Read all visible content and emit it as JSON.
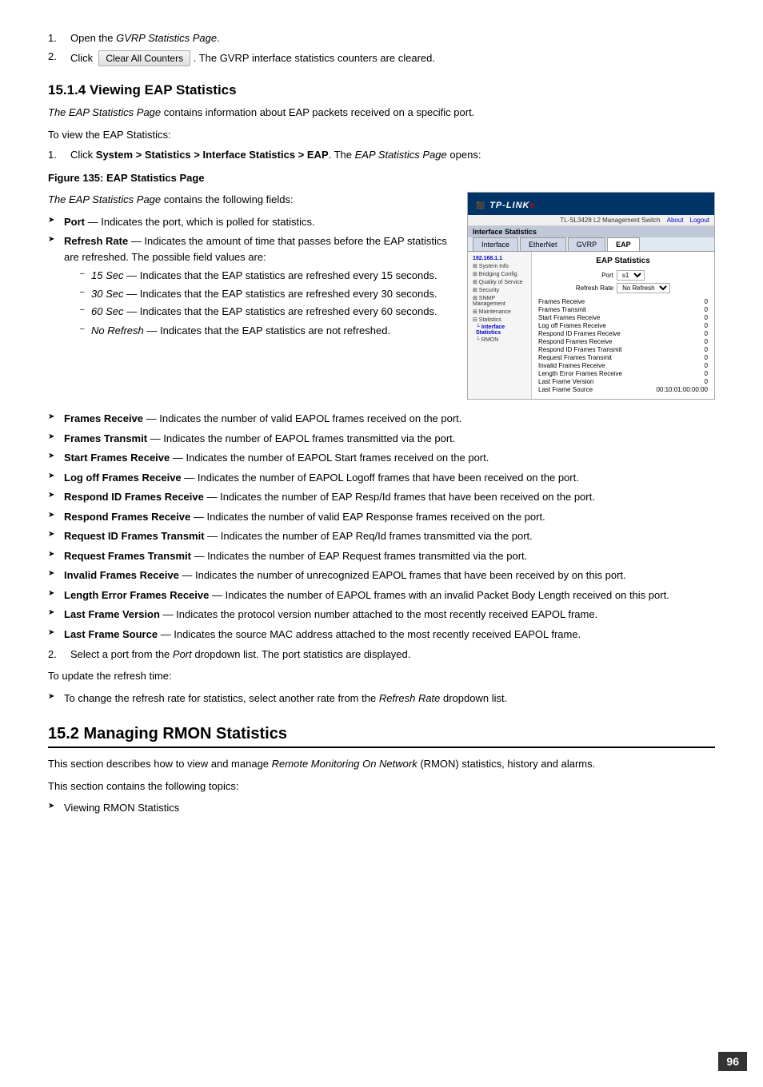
{
  "page": {
    "number": "96"
  },
  "steps_intro": [
    {
      "num": "1.",
      "text": "Open the ",
      "link": "GVRP Statistics Page",
      "suffix": "."
    },
    {
      "num": "2.",
      "text": "Click",
      "button": "Clear All Counters",
      "suffix": ". The GVRP interface statistics counters are cleared."
    }
  ],
  "section_154": {
    "heading": "15.1.4   Viewing EAP Statistics",
    "intro": "The EAP Statistics Page contains information about EAP packets received on a specific port.",
    "to_view": "To view the EAP Statistics:",
    "step1": "Click System > Statistics > Interface Statistics > EAP. The EAP Statistics Page opens:",
    "figure_caption": "Figure 135: EAP Statistics Page",
    "fields_intro": "The EAP Statistics Page contains the following fields:",
    "fields": [
      {
        "label": "Port",
        "desc": "— Indicates the port, which is polled for statistics."
      },
      {
        "label": "Refresh Rate",
        "desc": "— Indicates the amount of time that passes before the EAP statistics are refreshed. The possible field values are:"
      }
    ],
    "refresh_values": [
      "15 Sec — Indicates that the EAP statistics are refreshed every 15 seconds.",
      "30 Sec — Indicates that the EAP statistics are refreshed every 30 seconds.",
      "60 Sec — Indicates that the EAP statistics are refreshed every 60 seconds."
    ],
    "no_refresh": "– No Refresh — Indicates that the EAP statistics are not refreshed.",
    "more_fields": [
      {
        "label": "Frames Receive",
        "desc": "— Indicates the number of valid EAPOL frames received on the port."
      },
      {
        "label": "Frames Transmit",
        "desc": "— Indicates the number of EAPOL frames transmitted via the port."
      },
      {
        "label": "Start Frames Receive",
        "desc": "— Indicates the number of EAPOL Start frames received on the port."
      },
      {
        "label": "Log off Frames Receive",
        "desc": "— Indicates the number of EAPOL Logoff frames that have been received on the port."
      },
      {
        "label": "Respond ID Frames Receive",
        "desc": "— Indicates the number of EAP Resp/Id frames that have been received on the port."
      },
      {
        "label": "Respond Frames Receive",
        "desc": "— Indicates the number of valid EAP Response frames received on the port."
      },
      {
        "label": "Request ID Frames Transmit",
        "desc": "— Indicates the number of EAP Req/Id frames transmitted via the port."
      },
      {
        "label": "Request Frames Transmit",
        "desc": "— Indicates the number of EAP Request frames transmitted via the port."
      },
      {
        "label": "Invalid Frames Receive",
        "desc": "— Indicates the number of unrecognized EAPOL frames that have been received by on this port."
      },
      {
        "label": "Length Error Frames Receive",
        "desc": "— Indicates the number of EAPOL frames with an invalid Packet Body Length received on this port."
      },
      {
        "label": "Last Frame Version",
        "desc": "— Indicates the protocol version number attached to the most recently received EAPOL frame."
      },
      {
        "label": "Last Frame Source",
        "desc": "— Indicates the source MAC address attached to the most recently received EAPOL frame."
      }
    ],
    "step2": "Select a port from the Port dropdown list. The port statistics are displayed.",
    "update_refresh": "To update the refresh time:",
    "refresh_bullet": "To change the refresh rate for statistics, select another rate from the Refresh Rate dropdown list."
  },
  "section_152": {
    "heading": "15.2   Managing RMON Statistics",
    "intro": "This section describes how to view and manage Remote Monitoring On Network (RMON) statistics, history and alarms.",
    "topics_intro": "This section contains the following topics:",
    "topics": [
      "Viewing RMON Statistics"
    ]
  },
  "tp_link_ui": {
    "logo": "TP-LINK",
    "system_title": "TL-SL3428 L2 Management Switch",
    "nav_links": [
      "About",
      "Logout"
    ],
    "tabs": [
      "Interface",
      "EtherNet",
      "GVRP",
      "EAP"
    ],
    "active_tab": "EAP",
    "sidebar_items": [
      "192.168.1.1",
      "System Info",
      "Bridging Config",
      "Quality of Service",
      "Security",
      "SNMP Management",
      "Maintenance",
      "Statistics",
      "Interface Statistics",
      "RMON"
    ],
    "eap_stats": {
      "title": "EAP Statistics",
      "port_label": "Port",
      "port_value": "s1",
      "refresh_label": "Refresh Rate",
      "refresh_value": "No Refresh",
      "rows": [
        {
          "label": "Frames Receive",
          "value": "0"
        },
        {
          "label": "Frames Transmit",
          "value": "0"
        },
        {
          "label": "Start Frames Receive",
          "value": "0"
        },
        {
          "label": "Log off Frames Receive",
          "value": "0"
        },
        {
          "label": "Respond ID Frames Receive",
          "value": "0"
        },
        {
          "label": "Respond Frames Receive",
          "value": "0"
        },
        {
          "label": "Respond ID Frames Transmit",
          "value": "0"
        },
        {
          "label": "Request Frames Transmit",
          "value": "0"
        },
        {
          "label": "Invalid Frames Receive",
          "value": "0"
        },
        {
          "label": "Length Error Frames Receive",
          "value": "0"
        },
        {
          "label": "Last Frame Version",
          "value": "0"
        },
        {
          "label": "Last Frame Source",
          "value": "00:10:01:00:00:00"
        }
      ]
    }
  }
}
